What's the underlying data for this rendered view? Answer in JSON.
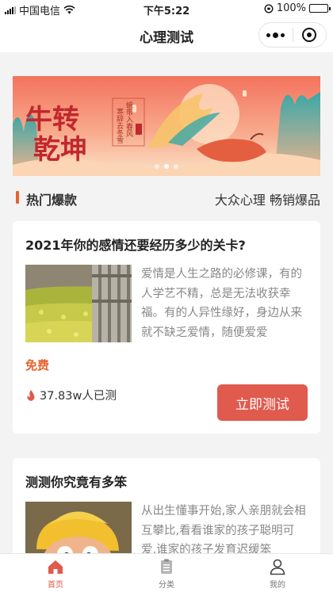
{
  "status_bar": {
    "carrier": "中国电信",
    "time": "下午5:22",
    "battery": "100%",
    "battery_level": 1.0
  },
  "nav": {
    "title": "心理测试"
  },
  "banner": {
    "headline_line1": "牛转",
    "headline_line2": "乾坤",
    "verse_line1": "蛾带入春风",
    "verse_line2": "寒辞去冬雪",
    "slides_total": 3,
    "slide_active": 2
  },
  "section": {
    "title": "热门爆款",
    "subtitle": "大众心理 畅销爆品"
  },
  "cards": [
    {
      "title": "2021年你的感情还要经历多少的关卡?",
      "description": "爱情是人生之路的必修课，有的人学艺不精，总是无法收获幸福。有的人异性缘好，身边从来就不缺乏爱情，随便爱爱",
      "price": "免费",
      "tested_count": "37.83w人已测",
      "button": "立即测试"
    },
    {
      "title": "测测你究竟有多笨",
      "description": "从出生懂事开始,家人亲朋就会相互攀比,看看谁家的孩子聪明可爱,谁家的孩子发育迟缓笨"
    }
  ],
  "tabs": [
    {
      "label": "首页",
      "icon": "home-icon",
      "active": true
    },
    {
      "label": "分类",
      "icon": "clipboard-icon",
      "active": false
    },
    {
      "label": "我的",
      "icon": "user-icon",
      "active": false
    }
  ],
  "colors": {
    "accent": "#e05a4e",
    "section_bar": "#e8612b"
  }
}
